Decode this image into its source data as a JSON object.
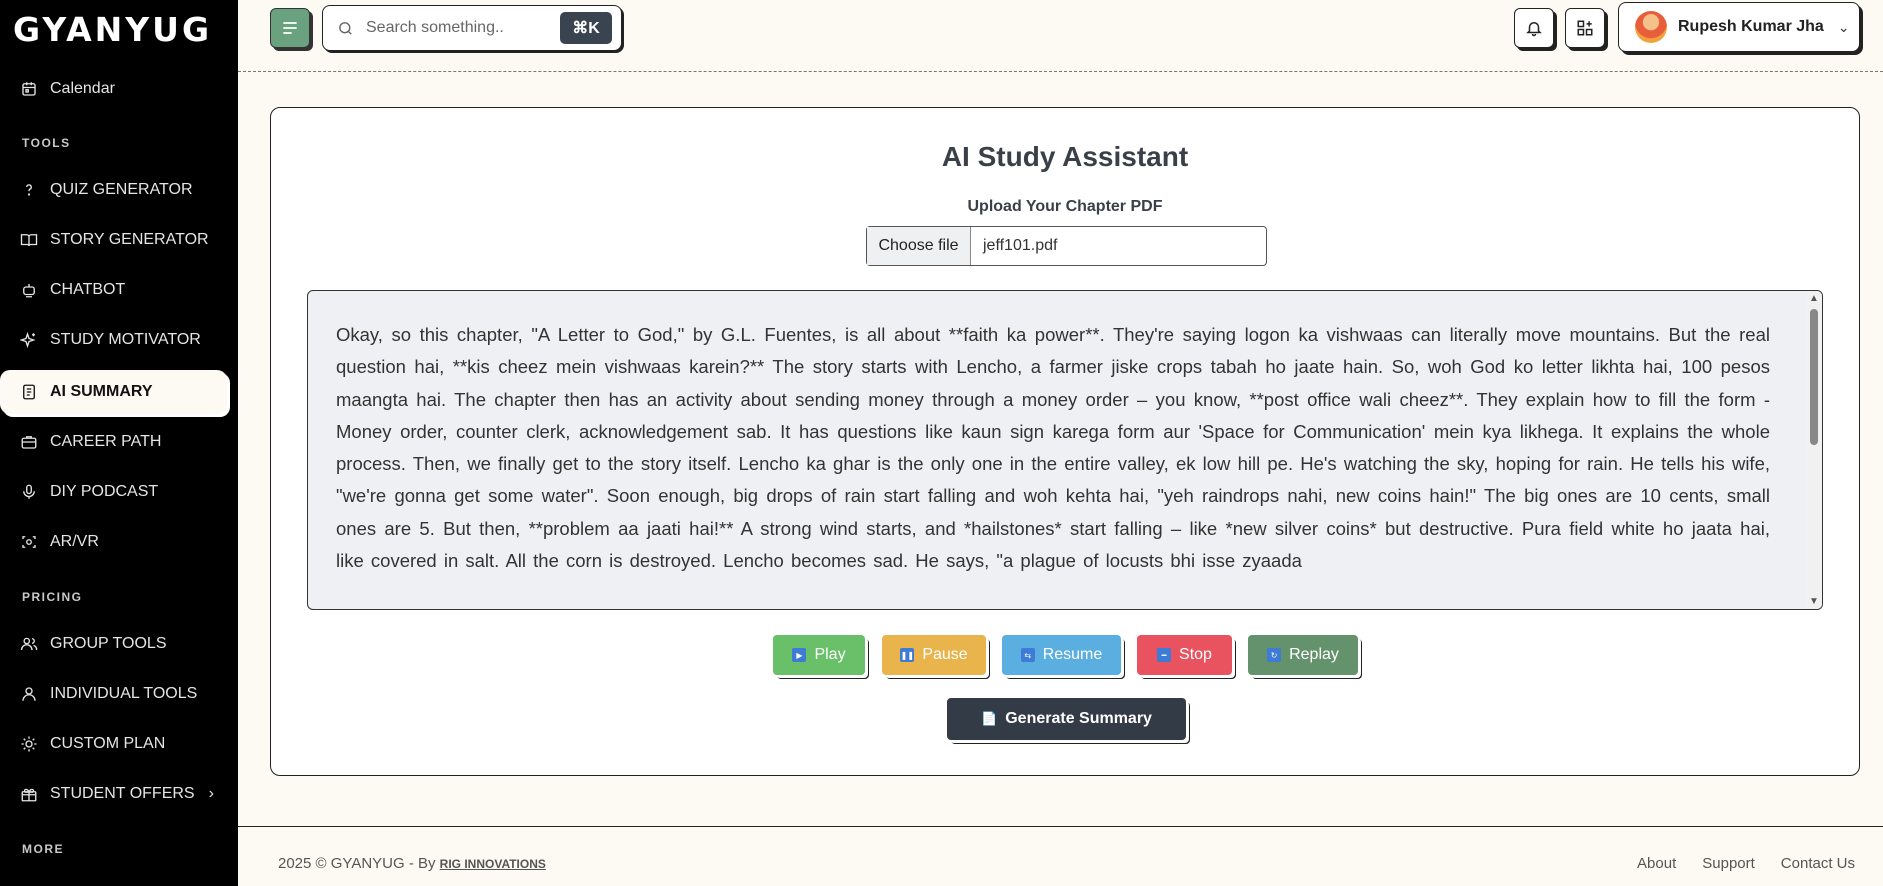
{
  "app": {
    "logo": "GYANYUG"
  },
  "sidebar": {
    "top_items": [
      {
        "label": "Calendar",
        "icon": "calendar-icon"
      }
    ],
    "sections": {
      "tools": "TOOLS",
      "pricing": "PRICING",
      "more": "MORE"
    },
    "tools": [
      {
        "label": "QUIZ GENERATOR",
        "icon": "question-icon"
      },
      {
        "label": "STORY GENERATOR",
        "icon": "book-icon"
      },
      {
        "label": "CHATBOT",
        "icon": "bot-icon"
      },
      {
        "label": "STUDY MOTIVATOR",
        "icon": "sparkle-icon"
      },
      {
        "label": "AI SUMMARY",
        "icon": "document-icon",
        "active": true
      },
      {
        "label": "CAREER PATH",
        "icon": "briefcase-icon"
      },
      {
        "label": "DIY PODCAST",
        "icon": "microphone-icon"
      },
      {
        "label": "AR/VR",
        "icon": "ar-icon"
      }
    ],
    "pricing": [
      {
        "label": "GROUP TOOLS",
        "icon": "users-icon"
      },
      {
        "label": "INDIVIDUAL TOOLS",
        "icon": "user-icon"
      },
      {
        "label": "CUSTOM PLAN",
        "icon": "bulb-icon"
      },
      {
        "label": "STUDENT OFFERS",
        "icon": "gift-icon",
        "chevron": "›"
      }
    ]
  },
  "header": {
    "search_placeholder": "Search something..",
    "shortcut": "⌘K",
    "user_name": "Rupesh Kumar Jha"
  },
  "main": {
    "title": "AI Study Assistant",
    "upload_label": "Upload Your Chapter PDF",
    "file_button": "Choose file",
    "file_name": "jeff101.pdf",
    "summary_text": "Okay, so this chapter, \"A Letter to God,\" by G.L. Fuentes, is all about **faith ka power**. They're saying logon ka vishwaas can literally move mountains. But the real question hai, **kis cheez mein vishwaas karein?** The story starts with Lencho, a farmer jiske crops tabah ho jaate hain. So, woh God ko letter likhta hai, 100 pesos maangta hai. The chapter then has an activity about sending money through a money order – you know, **post office wali cheez**. They explain how to fill the form - Money order, counter clerk, acknowledgement sab. It has questions like kaun sign karega form aur 'Space for Communication' mein kya likhega. It explains the whole process. Then, we finally get to the story itself. Lencho ka ghar is the only one in the entire valley, ek low hill pe. He's watching the sky, hoping for rain. He tells his wife, \"we're gonna get some water\". Soon enough, big drops of rain start falling and woh kehta hai, \"yeh raindrops nahi, new coins hain!\" The big ones are 10 cents, small ones are 5. But then, **problem aa jaati hai!** A strong wind starts, and *hailstones* start falling – like *new silver coins* but destructive. Pura field white ho jaata hai, like covered in salt. All the corn is destroyed. Lencho becomes sad. He says, \"a plague of locusts bhi isse zyaada",
    "controls": [
      {
        "label": "Play",
        "color": "#6abf69",
        "glyph": "▶"
      },
      {
        "label": "Pause",
        "color": "#e9b44c",
        "glyph": "❚❚"
      },
      {
        "label": "Resume",
        "color": "#5aaee0",
        "glyph": "⇆"
      },
      {
        "label": "Stop",
        "color": "#e8535f",
        "glyph": "━"
      },
      {
        "label": "Replay",
        "color": "#64926c",
        "glyph": "↻"
      }
    ],
    "generate_label": "Generate Summary",
    "generate_glyph": "📄"
  },
  "footer": {
    "copyright": "2025 © GYANYUG - By",
    "brand": "RIG INNOVATIONS",
    "links": [
      "About",
      "Support",
      "Contact Us"
    ]
  }
}
